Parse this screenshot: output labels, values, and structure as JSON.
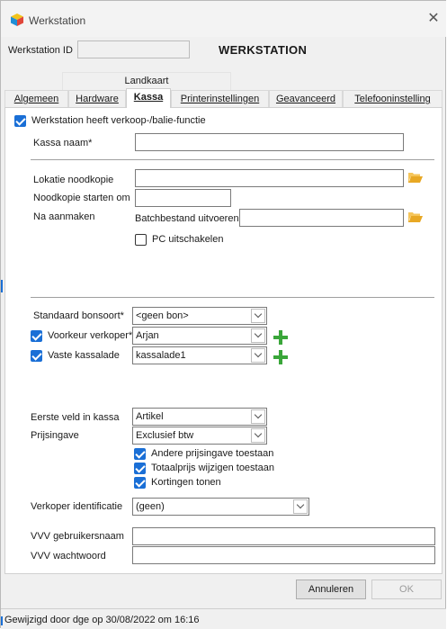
{
  "window": {
    "title": "Werkstation",
    "close_glyph": "✕"
  },
  "header": {
    "id_label": "Werkstation ID",
    "id_value": "",
    "heading": "WERKSTATION"
  },
  "tabs": {
    "row1": [
      {
        "label": "Landkaart"
      }
    ],
    "row2": [
      {
        "label": "Algemeen"
      },
      {
        "label": "Hardware"
      },
      {
        "label": "Kassa",
        "active": true
      },
      {
        "label": "Printerinstellingen"
      },
      {
        "label": "Geavanceerd"
      },
      {
        "label": "Telefooninstelling"
      }
    ]
  },
  "kassa": {
    "verkoop_label": "Werkstation heeft verkoop-/balie-functie",
    "verkoop_checked": true,
    "naam_label": "Kassa naam*",
    "naam_value": "",
    "lokatie_label": "Lokatie noodkopie",
    "lokatie_value": "",
    "starten_label": "Noodkopie starten om",
    "starten_value": "",
    "na_aanmaken_label": "Na aanmaken",
    "batch_label": "Batchbestand uitvoeren",
    "batch_value": "",
    "pc_uitschakelen_label": "PC uitschakelen",
    "pc_uitschakelen_checked": false,
    "bonsoort_label": "Standaard bonsoort*",
    "bonsoort_value": "<geen bon>",
    "verkoper_label": "Voorkeur verkoper*",
    "verkoper_checked": true,
    "verkoper_value": "Arjan",
    "kassalade_label": "Vaste kassalade",
    "kassalade_checked": true,
    "kassalade_value": "kassalade1",
    "eerste_veld_label": "Eerste veld in kassa",
    "eerste_veld_value": "Artikel",
    "prijsingave_label": "Prijsingave",
    "prijsingave_value": "Exclusief btw",
    "andere_prijsingave_label": "Andere prijsingave toestaan",
    "totaalprijs_label": "Totaalprijs wijzigen toestaan",
    "kortingen_label": "Kortingen tonen",
    "verkoper_id_label": "Verkoper identificatie",
    "verkoper_id_value": "(geen)",
    "vvv_user_label": "VVV gebruikersnaam",
    "vvv_user_value": "",
    "vvv_pass_label": "VVV wachtwoord",
    "vvv_pass_value": ""
  },
  "footer": {
    "cancel_label": "Annuleren",
    "ok_label": "OK"
  },
  "status": {
    "text": "Gewijzigd door dge op 30/08/2022 om 16:16"
  },
  "colors": {
    "accent": "#1a6fd6",
    "add": "#3aa63a",
    "folder": "#e8a824"
  },
  "icons": {
    "app": "app-cube-icon",
    "close": "close-icon",
    "folder": "folder-icon",
    "add": "plus-icon",
    "dropdown": "chevron-down-icon",
    "check": "checkmark-icon"
  }
}
